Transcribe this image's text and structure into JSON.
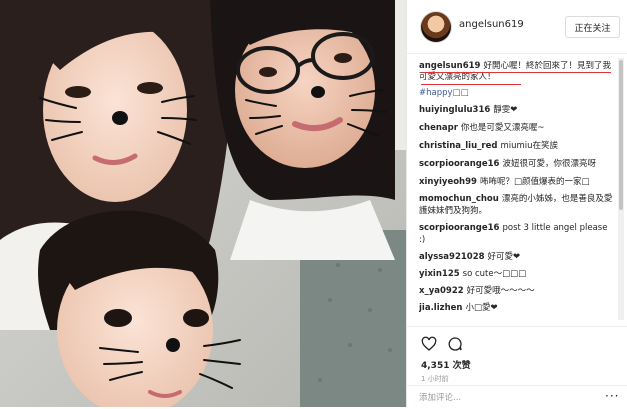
{
  "post": {
    "username": "angelsun619",
    "follow_label": "正在关注"
  },
  "caption": {
    "username": "angelsun619",
    "text": "好開心喔！終於回來了！見到了我可愛又漂亮的家人！",
    "hashtag": "#happy□□"
  },
  "comments": [
    {
      "user": "huiyinglulu316",
      "text": "靜雯❤"
    },
    {
      "user": "chenapr",
      "text": "你也是可愛又漂亮喔~"
    },
    {
      "user": "christina_liu_red",
      "text": "miumiu在笑誒"
    },
    {
      "user": "scorpioorange16",
      "text": "波妞很可愛，你很漂亮呀"
    },
    {
      "user": "xinyiyeoh99",
      "text": "咘咘呢？□颜值爆表的一家□"
    },
    {
      "user": "momochun_chou",
      "text": "漂亮的小姊姊，也是善良及愛護妹妹們及狗狗。"
    },
    {
      "user": "scorpioorange16",
      "text": "post 3 little angel please :)"
    },
    {
      "user": "alyssa921028",
      "text": "好可愛❤"
    },
    {
      "user": "yixin125",
      "text": "so cute～□□□"
    },
    {
      "user": "x_ya0922",
      "text": "好可愛哦～～～～"
    },
    {
      "user": "jia.lizhen",
      "text": "小□愛❤"
    }
  ],
  "stats": {
    "likes": "4,351 次赞",
    "time": "1 小时前"
  },
  "add_comment": {
    "placeholder": "添加评论...",
    "more": "···"
  },
  "colors": {
    "accent_red": "#e2323a",
    "hashtag": "#3b5998"
  }
}
